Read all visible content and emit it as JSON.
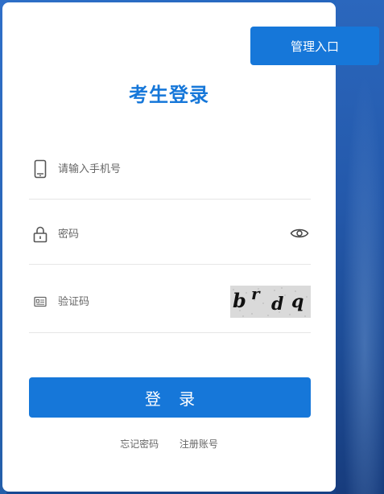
{
  "admin_button": {
    "label": "管理入口"
  },
  "login": {
    "title": "考生登录",
    "phone": {
      "placeholder": "请输入手机号",
      "icon": "phone-icon"
    },
    "password": {
      "placeholder": "密码",
      "icon": "lock-icon",
      "toggle_icon": "eye-icon"
    },
    "captcha": {
      "placeholder": "验证码",
      "icon": "id-card-icon",
      "image_text": "b r d q"
    },
    "submit_label": "登 录",
    "links": [
      {
        "label": "忘记密码"
      },
      {
        "label": "注册账号"
      }
    ]
  },
  "colors": {
    "accent": "#1677d9",
    "background": "#1f5fb8"
  }
}
